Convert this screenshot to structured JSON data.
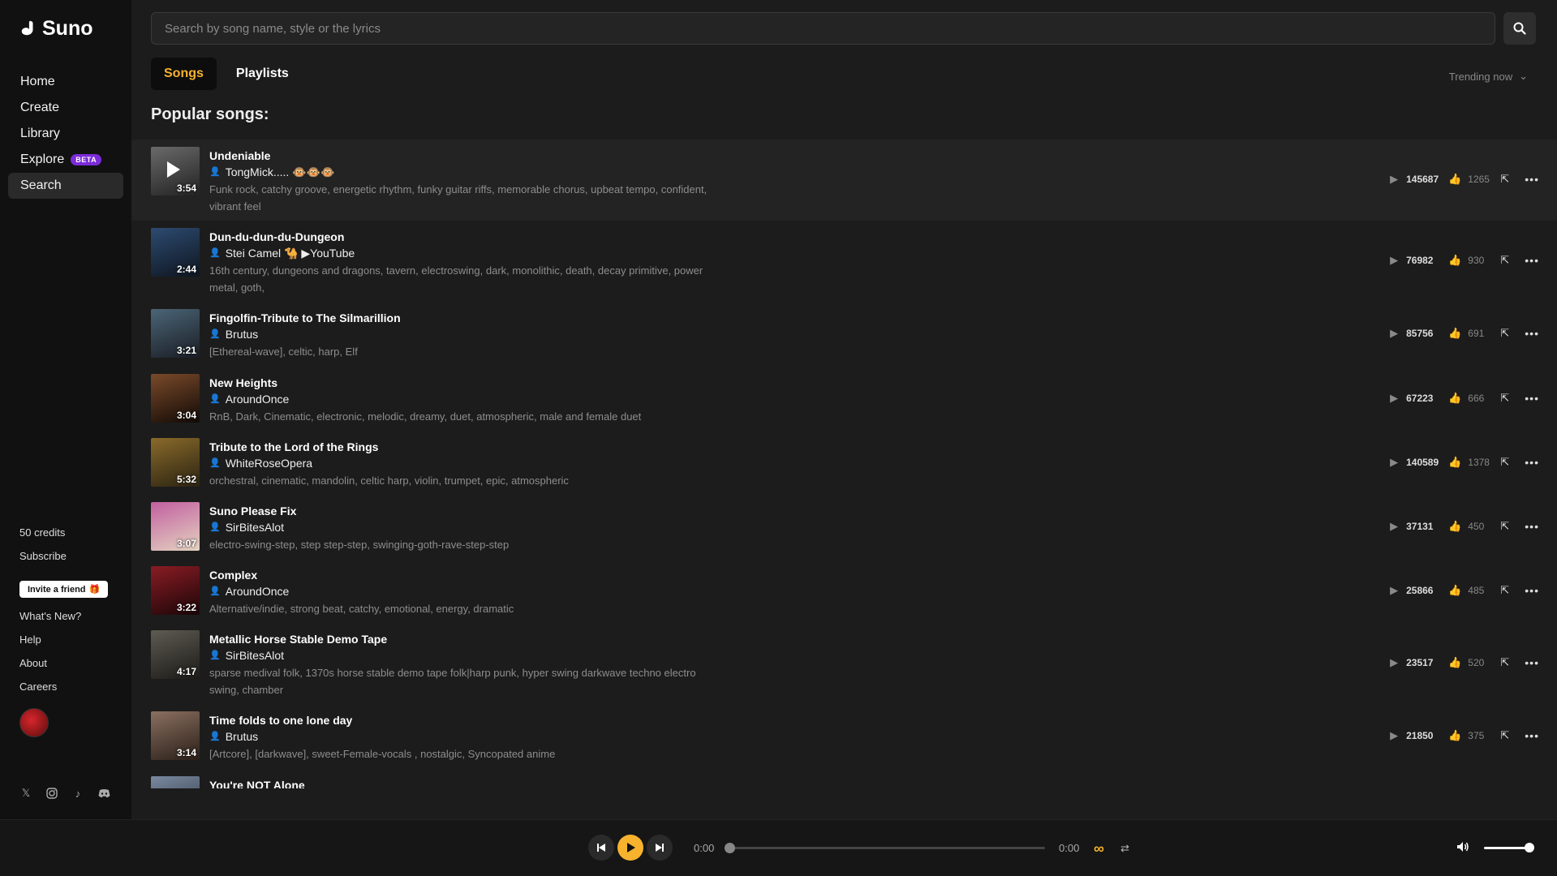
{
  "brand": {
    "name": "Suno"
  },
  "sidebar": {
    "items": [
      {
        "label": "Home",
        "active": false
      },
      {
        "label": "Create",
        "active": false
      },
      {
        "label": "Library",
        "active": false
      },
      {
        "label": "Explore",
        "badge": "BETA",
        "active": false
      },
      {
        "label": "Search",
        "active": true
      }
    ],
    "credits": "50 credits",
    "subscribe": "Subscribe",
    "invite": "Invite a friend",
    "links": [
      "What's New?",
      "Help",
      "About",
      "Careers"
    ],
    "socials": [
      "x-icon",
      "instagram-icon",
      "tiktok-icon",
      "discord-icon"
    ]
  },
  "search": {
    "placeholder": "Search by song name, style or the lyrics",
    "value": ""
  },
  "tabs": [
    {
      "label": "Songs",
      "active": true
    },
    {
      "label": "Playlists",
      "active": false
    }
  ],
  "sort": {
    "label": "Trending now"
  },
  "heading": "Popular songs:",
  "songs": [
    {
      "title": "Undeniable",
      "artist": "TongMick..... 🐵🐵🐵",
      "tags": "Funk rock, catchy groove, energetic rhythm, funky guitar riffs, memorable chorus, upbeat tempo, confident, vibrant feel",
      "duration": "3:54",
      "plays": "145687",
      "likes": "1265",
      "active": true,
      "thumb": [
        "#6a6a6a",
        "#222"
      ]
    },
    {
      "title": "Dun-du-dun-du-Dungeon",
      "artist": "Stei Camel 🐪 ▶YouTube",
      "tags": "16th century, dungeons and dragons, tavern, electroswing, dark, monolithic, death, decay primitive, power metal, goth,",
      "duration": "2:44",
      "plays": "76982",
      "likes": "930",
      "active": false,
      "thumb": [
        "#2d4b70",
        "#0e1520"
      ]
    },
    {
      "title": "Fingolfin-Tribute to The Silmarillion",
      "artist": "Brutus",
      "tags": "[Ethereal-wave], celtic, harp, Elf",
      "duration": "3:21",
      "plays": "85756",
      "likes": "691",
      "active": false,
      "thumb": [
        "#4b6577",
        "#1a1d24"
      ]
    },
    {
      "title": "New Heights",
      "artist": "AroundOnce",
      "tags": "RnB, Dark, Cinematic, electronic, melodic, dreamy, duet, atmospheric, male and female duet",
      "duration": "3:04",
      "plays": "67223",
      "likes": "666",
      "active": false,
      "thumb": [
        "#7a4a2a",
        "#120a06"
      ]
    },
    {
      "title": "Tribute to the Lord of the Rings",
      "artist": "WhiteRoseOpera",
      "tags": "orchestral, cinematic, mandolin, celtic harp, violin, trumpet, epic, atmospheric",
      "duration": "5:32",
      "plays": "140589",
      "likes": "1378",
      "active": false,
      "thumb": [
        "#8a6a2a",
        "#2a2312"
      ]
    },
    {
      "title": "Suno Please Fix",
      "artist": "SirBitesAlot",
      "tags": "electro-swing-step, step step-step, swinging-goth-rave-step-step",
      "duration": "3:07",
      "plays": "37131",
      "likes": "450",
      "active": false,
      "thumb": [
        "#c25fa0",
        "#e4d3c0"
      ]
    },
    {
      "title": "Complex",
      "artist": "AroundOnce",
      "tags": "Alternative/indie, strong beat, catchy, emotional, energy, dramatic",
      "duration": "3:22",
      "plays": "25866",
      "likes": "485",
      "active": false,
      "thumb": [
        "#8a1c24",
        "#1a0608"
      ]
    },
    {
      "title": "Metallic Horse Stable Demo Tape",
      "artist": "SirBitesAlot",
      "tags": "sparse medival folk, 1370s horse stable demo tape folk|harp punk, hyper swing darkwave techno electro swing, chamber",
      "duration": "4:17",
      "plays": "23517",
      "likes": "520",
      "active": false,
      "thumb": [
        "#5e5b52",
        "#1b1a17"
      ]
    },
    {
      "title": "Time folds to one lone day",
      "artist": "Brutus",
      "tags": "[Artcore], [darkwave], sweet-Female-vocals , nostalgic, Syncopated anime",
      "duration": "3:14",
      "plays": "21850",
      "likes": "375",
      "active": false,
      "thumb": [
        "#8a7060",
        "#2a1e18"
      ]
    },
    {
      "title": "You're NOT Alone",
      "artist": "",
      "tags": "",
      "duration": "",
      "plays": "",
      "likes": "",
      "active": false,
      "thumb": [
        "#7a8aa0",
        "#2a3040"
      ]
    }
  ],
  "player": {
    "elapsed": "0:00",
    "total": "0:00",
    "progress": 0,
    "volume": 1.0,
    "accent": "#f7b22e"
  }
}
